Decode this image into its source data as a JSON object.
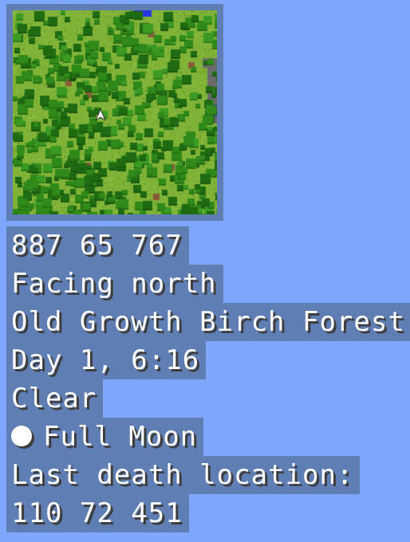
{
  "colors": {
    "sky": "#7ea6fd",
    "hud_bg": "#5f7fb4",
    "text": "#ffffff",
    "text_shadow": "#3d3d3d",
    "map_grass": "#7fb237",
    "map_tree_dark": "#1f6b12",
    "map_tree": "#2f8a1a",
    "map_water": "#2836e0",
    "map_stone": "#6b6b6b",
    "map_dirt": "#8a5a3a"
  },
  "minimap": {
    "player_marker": "player-arrow-icon"
  },
  "hud": {
    "coordinates": "887 65 767",
    "facing": "Facing north",
    "biome": "Old Growth Birch Forest",
    "day_time": "Day 1, 6:16",
    "weather": "Clear",
    "moon_icon": "full-moon-icon",
    "moon_phase": "Full Moon",
    "last_death_label": "Last death location:",
    "last_death_coords": "110 72 451"
  }
}
